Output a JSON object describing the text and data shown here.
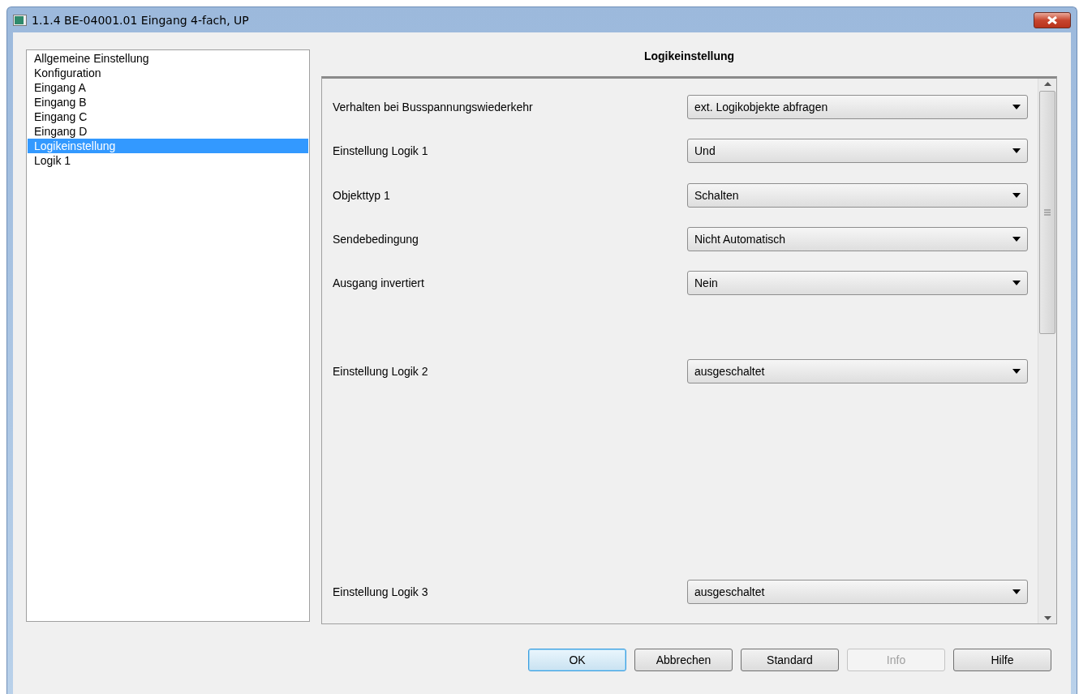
{
  "window": {
    "title": "1.1.4 BE-04001.01 Eingang 4-fach, UP"
  },
  "sidebar": {
    "items": [
      {
        "label": "Allgemeine Einstellung",
        "selected": false
      },
      {
        "label": "Konfiguration",
        "selected": false
      },
      {
        "label": "Eingang A",
        "selected": false
      },
      {
        "label": "Eingang B",
        "selected": false
      },
      {
        "label": "Eingang C",
        "selected": false
      },
      {
        "label": "Eingang D",
        "selected": false
      },
      {
        "label": "Logikeinstellung",
        "selected": true
      },
      {
        "label": "Logik 1",
        "selected": false
      }
    ]
  },
  "panel": {
    "title": "Logikeinstellung",
    "rows": [
      {
        "kind": "setting",
        "label": "Verhalten bei Busspannungswiederkehr",
        "value": "ext. Logikobjekte abfragen"
      },
      {
        "kind": "setting",
        "label": "Einstellung Logik 1",
        "value": "Und"
      },
      {
        "kind": "setting",
        "label": "Objekttyp 1",
        "value": "Schalten"
      },
      {
        "kind": "setting",
        "label": "Sendebedingung",
        "value": "Nicht Automatisch"
      },
      {
        "kind": "setting",
        "label": "Ausgang invertiert",
        "value": "Nein"
      },
      {
        "kind": "spacer"
      },
      {
        "kind": "setting",
        "label": "Einstellung Logik 2",
        "value": "ausgeschaltet"
      },
      {
        "kind": "spacer"
      },
      {
        "kind": "spacer"
      },
      {
        "kind": "spacer"
      },
      {
        "kind": "spacer"
      },
      {
        "kind": "setting",
        "label": "Einstellung Logik 3",
        "value": "ausgeschaltet"
      }
    ]
  },
  "buttons": [
    {
      "label": "OK",
      "default": true,
      "disabled": false
    },
    {
      "label": "Abbrechen",
      "default": false,
      "disabled": false
    },
    {
      "label": "Standard",
      "default": false,
      "disabled": false
    },
    {
      "label": "Info",
      "default": false,
      "disabled": true
    },
    {
      "label": "Hilfe",
      "default": false,
      "disabled": false
    }
  ]
}
